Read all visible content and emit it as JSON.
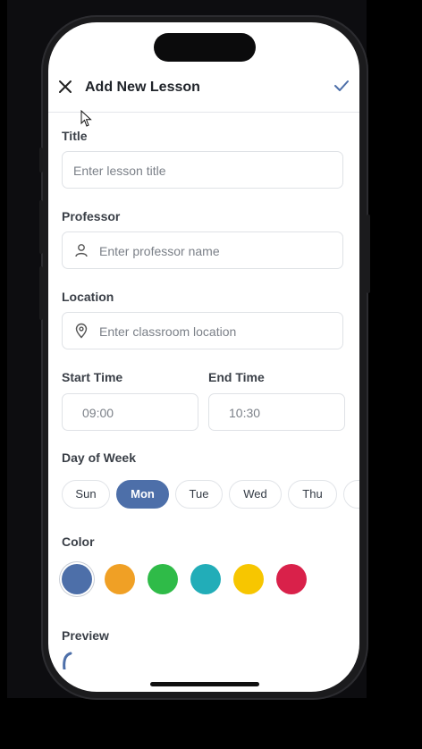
{
  "header": {
    "title": "Add New Lesson"
  },
  "fields": {
    "title": {
      "label": "Title",
      "placeholder": "Enter lesson title"
    },
    "professor": {
      "label": "Professor",
      "placeholder": "Enter professor name"
    },
    "location": {
      "label": "Location",
      "placeholder": "Enter classroom location"
    },
    "start_time": {
      "label": "Start Time",
      "value": "09:00"
    },
    "end_time": {
      "label": "End Time",
      "value": "10:30"
    }
  },
  "day_of_week": {
    "label": "Day of Week",
    "days": [
      "Sun",
      "Mon",
      "Tue",
      "Wed",
      "Thu"
    ],
    "selected": "Mon"
  },
  "color": {
    "label": "Color",
    "options": [
      "#4d6fa9",
      "#f0a025",
      "#2fbb48",
      "#22adb8",
      "#f7c600",
      "#d9214a"
    ],
    "selected": "#4d6fa9"
  },
  "preview": {
    "label": "Preview"
  },
  "icons": {
    "close": "close-icon",
    "confirm": "checkmark-icon",
    "professor": "person-icon",
    "location": "map-pin-icon"
  }
}
